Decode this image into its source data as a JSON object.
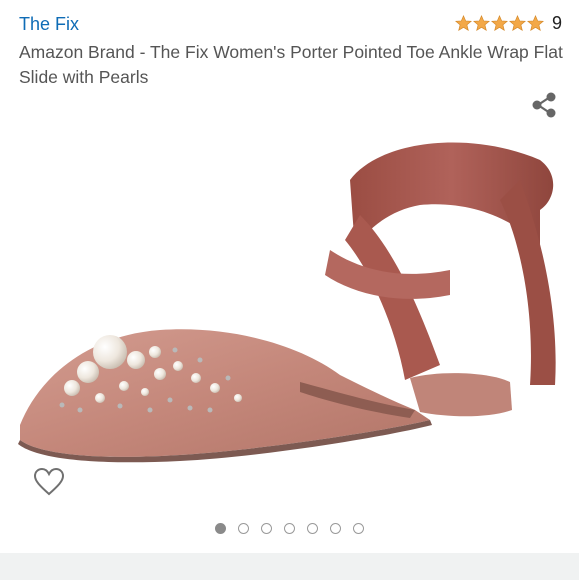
{
  "header": {
    "brand": "The Fix",
    "rating_count": "9",
    "stars": 5,
    "star_color": "#f3a847"
  },
  "product": {
    "title": "Amazon Brand - The Fix Women's Porter Pointed Toe Ankle Wrap Flat Slide with Pearls"
  },
  "icons": {
    "share": "share-icon",
    "wishlist": "heart-icon"
  },
  "carousel": {
    "total": 7,
    "active_index": 0
  },
  "colors": {
    "brand_link": "#0f6cb6",
    "shoe_velvet": "#c68a7e",
    "ribbon": "#a4574c"
  }
}
